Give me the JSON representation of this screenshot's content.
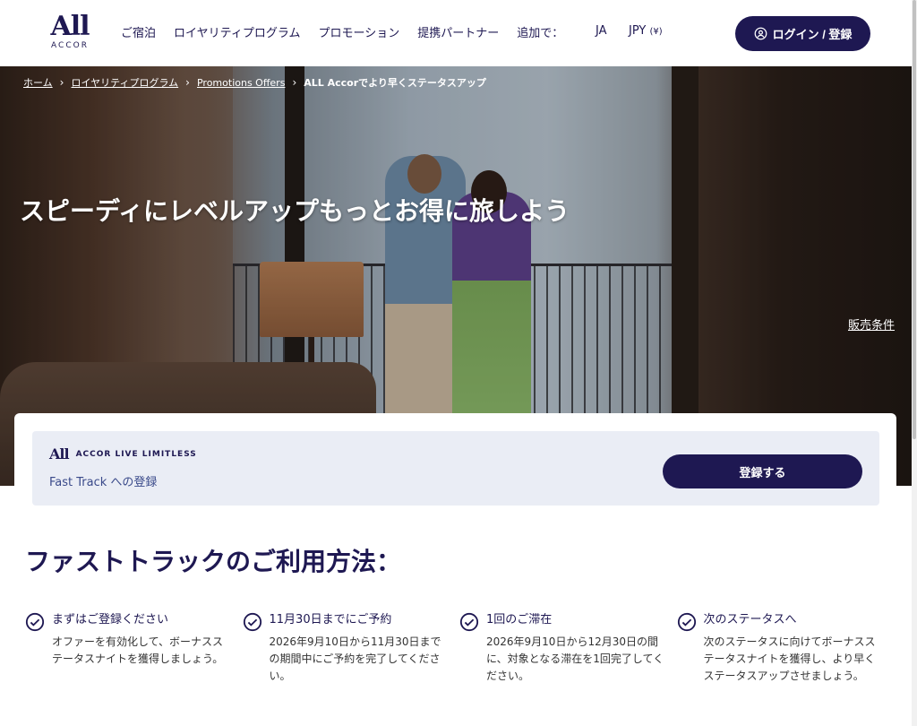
{
  "header": {
    "logo_main": "All",
    "logo_sub": "ACCOR",
    "nav": [
      "ご宿泊",
      "ロイヤリティプログラム",
      "プロモーション",
      "提携パートナー",
      "追加で："
    ],
    "language": "JA",
    "currency_code": "JPY",
    "currency_symbol": "(¥)",
    "login_label": "ログイン / 登録",
    "login_icon": "user-circle-icon"
  },
  "breadcrumb": {
    "items": [
      "ホーム",
      "ロイヤリティプログラム",
      "Promotions Offers"
    ],
    "current": "ALL Accorでより早くステータスアップ"
  },
  "hero": {
    "title": "スピーディにレベルアップもっとお得に旅しよう",
    "terms_link": "販売条件"
  },
  "register_card": {
    "brand_mark": "All",
    "brand_text": "ACCOR LIVE LIMITLESS",
    "label": "Fast Track への登録",
    "button_label": "登録する"
  },
  "how_to": {
    "title": "ファストトラックのご利用方法：",
    "steps": [
      {
        "title": "まずはご登録ください",
        "desc": "オファーを有効化して、ボーナスステータスナイトを獲得しましょう。"
      },
      {
        "title": "11月30日までにご予約",
        "desc": "2026年9月10日から11月30日までの期間中にご予約を完了してください。"
      },
      {
        "title": "1回のご滞在",
        "desc": "2026年9月10日から12月30日の間に、対象となる滞在を1回完了してください。"
      },
      {
        "title": "次のステータスへ",
        "desc": "次のステータスに向けてボーナスステータスナイトを獲得し、より早くステータスアップさせましょう。"
      }
    ],
    "step_icon": "check-circle-icon"
  },
  "colors": {
    "brand_navy": "#1e1852",
    "card_bg": "#eaedf5"
  }
}
